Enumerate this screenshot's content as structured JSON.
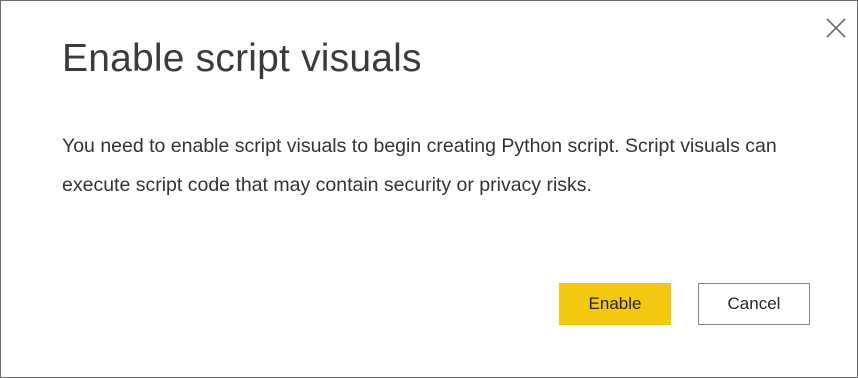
{
  "dialog": {
    "title": "Enable script visuals",
    "message": "You need to enable script visuals to begin creating Python script. Script visuals can execute script code that may contain security or privacy risks.",
    "close_icon": "close-icon",
    "buttons": {
      "enable_label": "Enable",
      "cancel_label": "Cancel"
    }
  },
  "colors": {
    "primary_button": "#f2c811",
    "title_text": "#3b3b3b",
    "body_text": "#333333",
    "border": "#6b6b6b"
  }
}
